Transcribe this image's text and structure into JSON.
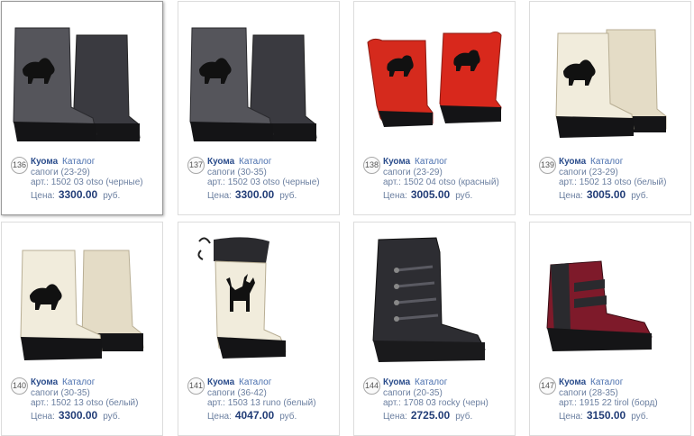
{
  "products": [
    {
      "num": "136",
      "brand": "Куома",
      "catalog": "Каталог",
      "name": "сапоги (23-29)",
      "art": "арт.: 1502 03 otso (черные)",
      "price_label": "Цена:",
      "price": "3300.00",
      "currency": "руб.",
      "image": "felt-boot-grey-bear-icon",
      "felt_color": "#4a4a4f"
    },
    {
      "num": "137",
      "brand": "Куома",
      "catalog": "Каталог",
      "name": "сапоги (30-35)",
      "art": "арт.: 1502 03 otso (черные)",
      "price_label": "Цена:",
      "price": "3300.00",
      "currency": "руб.",
      "image": "felt-boot-grey-bear-icon",
      "felt_color": "#4a4a4f"
    },
    {
      "num": "138",
      "brand": "Куома",
      "catalog": "Каталог",
      "name": "сапоги (23-29)",
      "art": "арт.: 1502 04 otso (красный)",
      "price_label": "Цена:",
      "price": "3005.00",
      "currency": "руб.",
      "image": "felt-boot-red-bear-icon",
      "felt_color": "#d8281c"
    },
    {
      "num": "139",
      "brand": "Куома",
      "catalog": "Каталог",
      "name": "сапоги (23-29)",
      "art": "арт.: 1502 13 otso (белый)",
      "price_label": "Цена:",
      "price": "3005.00",
      "currency": "руб.",
      "image": "felt-boot-white-bear-icon",
      "felt_color": "#efe9d8"
    },
    {
      "num": "140",
      "brand": "Куома",
      "catalog": "Каталог",
      "name": "сапоги (30-35)",
      "art": "арт.: 1502 13 otso (белый)",
      "price_label": "Цена:",
      "price": "3300.00",
      "currency": "руб.",
      "image": "felt-boot-white-bear-icon",
      "felt_color": "#efe9d8"
    },
    {
      "num": "141",
      "brand": "Куома",
      "catalog": "Каталог",
      "name": "сапоги (36-42)",
      "art": "арт.: 1503 13 runo (белый)",
      "price_label": "Цена:",
      "price": "4047.00",
      "currency": "руб.",
      "image": "felt-boot-white-deer-icon",
      "felt_color": "#efe9d8"
    },
    {
      "num": "144",
      "brand": "Куома",
      "catalog": "Каталог",
      "name": "сапоги (20-35)",
      "art": "арт.: 1708 03 rocky (черн)",
      "price_label": "Цена:",
      "price": "2725.00",
      "currency": "руб.",
      "image": "winter-boot-black-laced-icon",
      "felt_color": "#2a2a2e"
    },
    {
      "num": "147",
      "brand": "Куома",
      "catalog": "Каталог",
      "name": "сапоги (28-35)",
      "art": "арт.: 1915 22 tirol (борд)",
      "price_label": "Цена:",
      "price": "3150.00",
      "currency": "руб.",
      "image": "winter-boot-burgundy-strap-icon",
      "felt_color": "#7e1a2a"
    }
  ]
}
